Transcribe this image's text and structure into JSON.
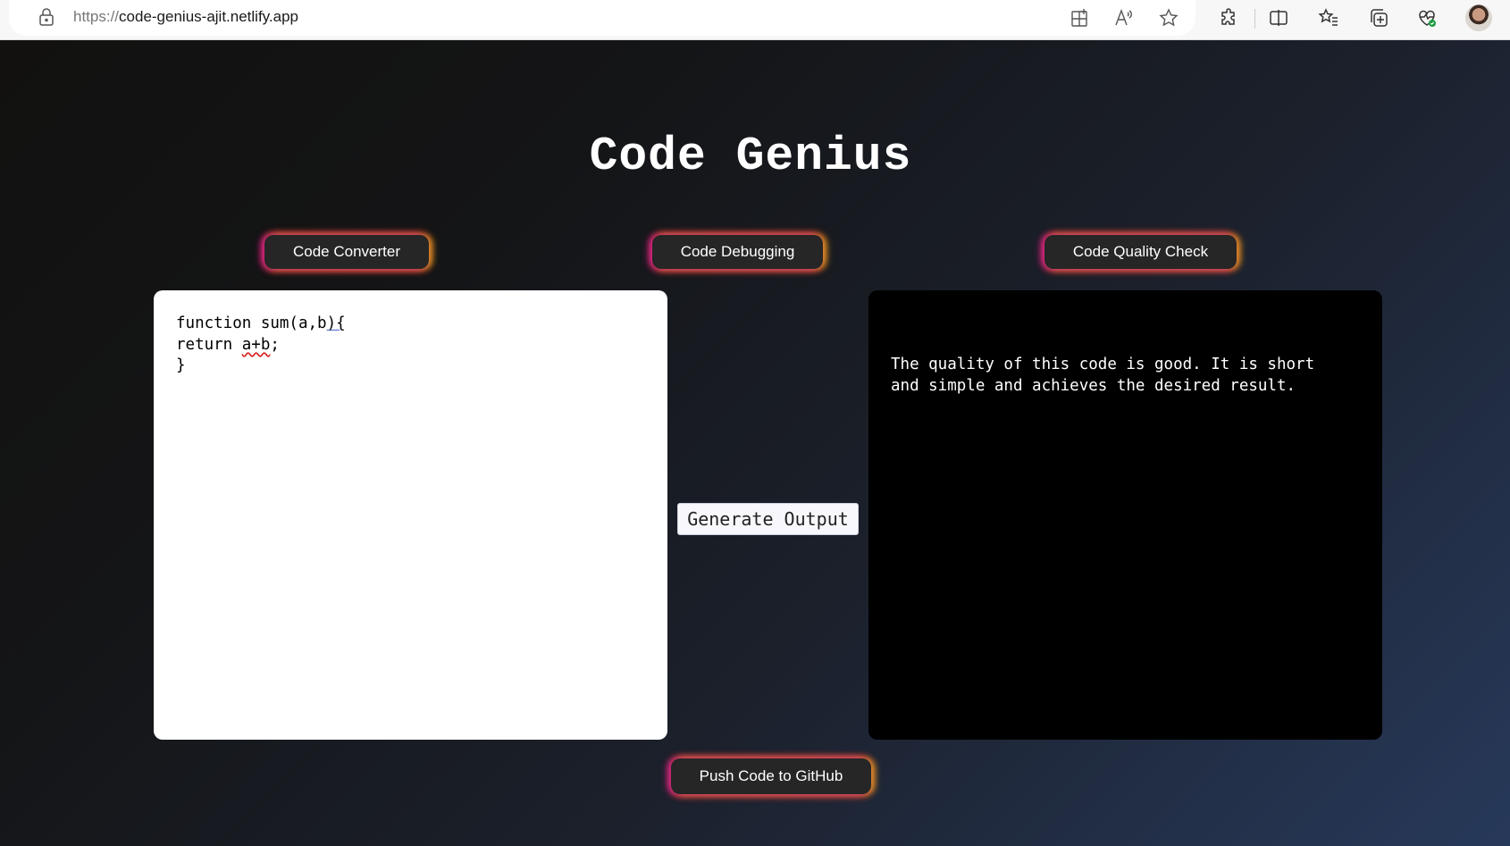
{
  "browser": {
    "url_protocol": "https://",
    "url_host": "code-genius-ajit.netlify.app",
    "toolbar_icons": [
      "lock-icon",
      "app-available-icon",
      "read-aloud-icon",
      "favorite-star-icon",
      "extensions-icon",
      "split-screen-icon",
      "favorites-icon",
      "collections-icon",
      "browser-essentials-icon",
      "profile-avatar"
    ]
  },
  "app": {
    "title": "Code Genius",
    "tabs": [
      {
        "label": "Code Converter"
      },
      {
        "label": "Code Debugging"
      },
      {
        "label": "Code Quality Check"
      }
    ],
    "input": {
      "lines": [
        "function sum(a,b){",
        "return a+b;",
        "}"
      ]
    },
    "generate_label": "Generate Output",
    "output_text": "The quality of this code is good. It is short\nand simple and achieves the desired result.",
    "push_label": "Push Code to GitHub"
  },
  "colors": {
    "glow_left": "#e0148a",
    "glow_mid": "#e8302a",
    "glow_right": "#f0a020",
    "button_bg": "#262626"
  }
}
